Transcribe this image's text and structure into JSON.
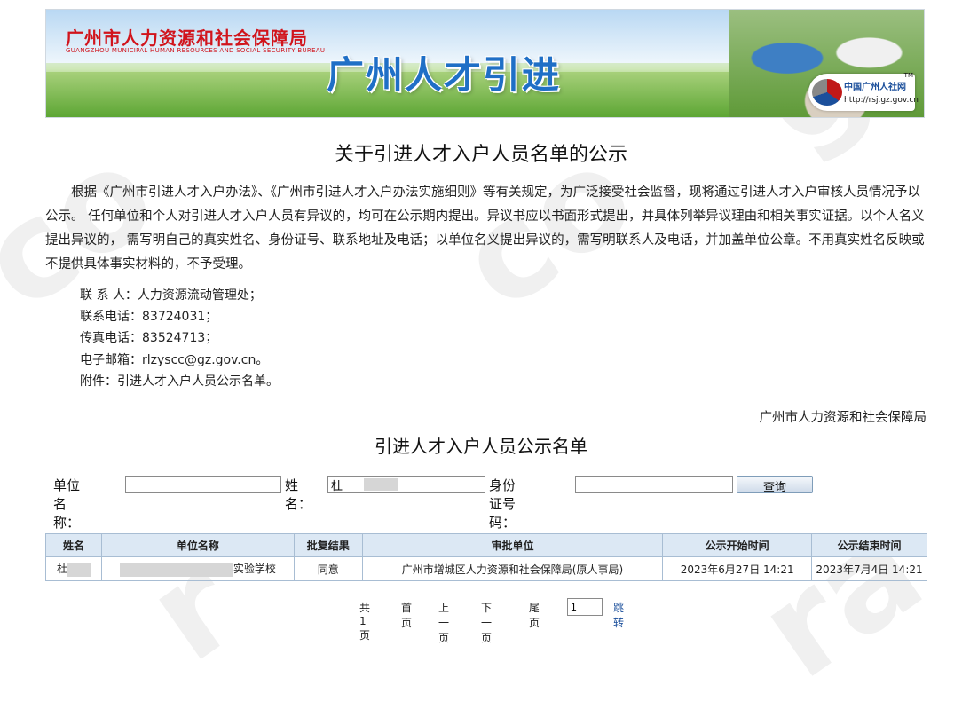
{
  "header": {
    "org_cn": "广州市人力资源和社会保障局",
    "org_en": "GUANGZHOU MUNICIPAL HUMAN RESOURCES AND SOCIAL SECURITY BUREAU",
    "slogan": "广州人才引进",
    "logo_name": "中国广州人社网",
    "logo_url": "http://rsj.gz.gov.cn",
    "logo_tm": "TM"
  },
  "notice": {
    "title": "关于引进人才入户人员名单的公示",
    "body": "根据《广州市引进人才入户办法》、《广州市引进人才入户办法实施细则》等有关规定，为广泛接受社会监督，现将通过引进人才入户审核人员情况予以公示。 任何单位和个人对引进人才入户人员有异议的，均可在公示期内提出。异议书应以书面形式提出，并具体列举异议理由和相关事实证据。以个人名义提出异议的， 需写明自己的真实姓名、身份证号、联系地址及电话；以单位名义提出异议的，需写明联系人及电话，并加盖单位公章。不用真实姓名反映或不提供具体事实材料的，不予受理。",
    "contact_person": "联 系 人：人力资源流动管理处；",
    "phone": "联系电话：83724031；",
    "fax": "传真电话：83524713；",
    "email": "电子邮箱：rlzyscc@gz.gov.cn。",
    "attachment": "附件：引进人才入户人员公示名单。",
    "signature": "广州市人力资源和社会保障局"
  },
  "list_title": "引进人才入户人员公示名单",
  "search": {
    "unit_label": "单位名称：",
    "unit_value": "",
    "name_label": "姓名：",
    "name_value": "杜",
    "id_label": "身份证号码：",
    "id_value": "",
    "query_button": "查询"
  },
  "table": {
    "headers": [
      "姓名",
      "单位名称",
      "批复结果",
      "审批单位",
      "公示开始时间",
      "公示结束时间"
    ],
    "rows": [
      {
        "name": "杜",
        "unit": "实验学校",
        "result": "同意",
        "approver": "广州市增城区人力资源和社会保障局(原人事局)",
        "start": "2023年6月27日 14:21",
        "end": "2023年7月4日 14:21"
      }
    ]
  },
  "pager": {
    "total": "共1页",
    "first": "首页",
    "prev": "上一页",
    "next": "下一页",
    "last": "尾页",
    "page_value": "1",
    "go": "跳转"
  }
}
